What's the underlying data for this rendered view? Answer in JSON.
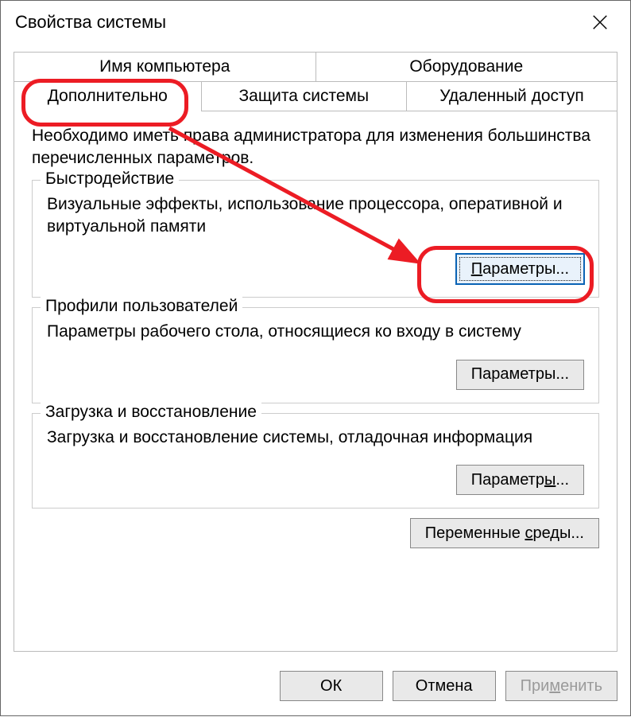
{
  "window": {
    "title": "Свойства системы"
  },
  "tabs": {
    "row1": [
      {
        "label": "Имя компьютера"
      },
      {
        "label": "Оборудование"
      }
    ],
    "row2": [
      {
        "label": "Дополнительно",
        "active": true
      },
      {
        "label": "Защита системы"
      },
      {
        "label": "Удаленный доступ"
      }
    ]
  },
  "panel": {
    "admin_note": "Необходимо иметь права администратора для изменения большинства перечисленных параметров."
  },
  "groups": {
    "performance": {
      "legend": "Быстродействие",
      "desc": "Визуальные эффекты, использование процессора, оперативной и виртуальной памяти",
      "button_pre": "",
      "button_ul": "П",
      "button_post": "араметры..."
    },
    "profiles": {
      "legend": "Профили пользователей",
      "desc": "Параметры рабочего стола, относящиеся ко входу в систему",
      "button": "Параметры..."
    },
    "startup": {
      "legend": "Загрузка и восстановление",
      "desc": "Загрузка и восстановление системы, отладочная информация",
      "button_pre": "Параметр",
      "button_ul": "ы",
      "button_post": "..."
    }
  },
  "env_button_pre": "Переменные ",
  "env_button_ul": "с",
  "env_button_post": "реды...",
  "dialog": {
    "ok": "ОК",
    "cancel": "Отмена",
    "apply_pre": "При",
    "apply_ul": "м",
    "apply_post": "енить"
  }
}
